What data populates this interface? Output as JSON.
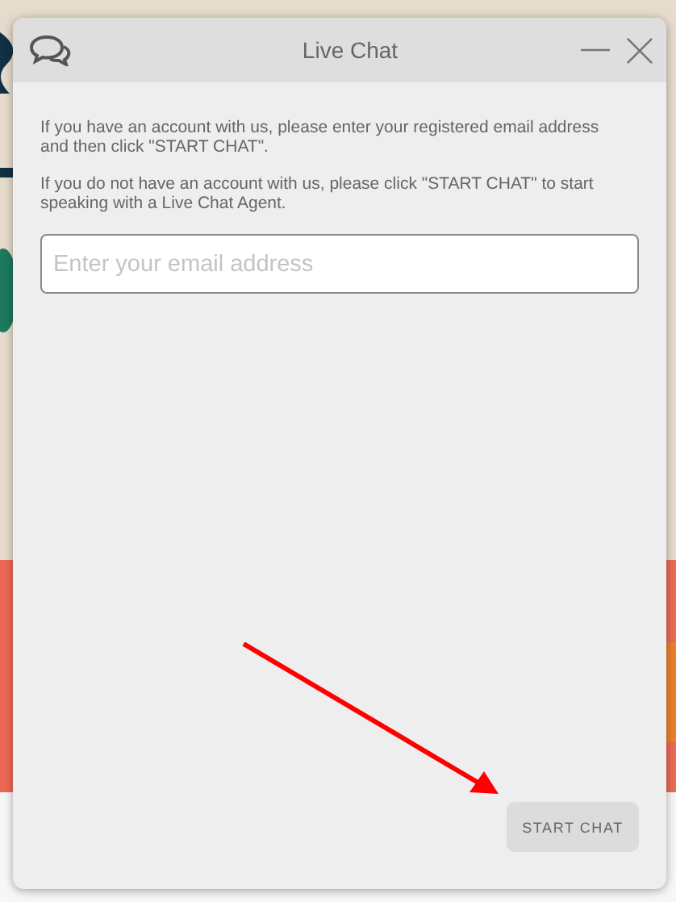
{
  "window": {
    "title": "Live Chat"
  },
  "messages": [
    "If you have an account with us, please enter your registered email address and then click \"START CHAT\".",
    "If you do not have an account with us, please click \"START CHAT\" to start speaking with a Live Chat Agent."
  ],
  "email_field": {
    "placeholder": "Enter your email address"
  },
  "start_button": {
    "label": "START CHAT"
  }
}
